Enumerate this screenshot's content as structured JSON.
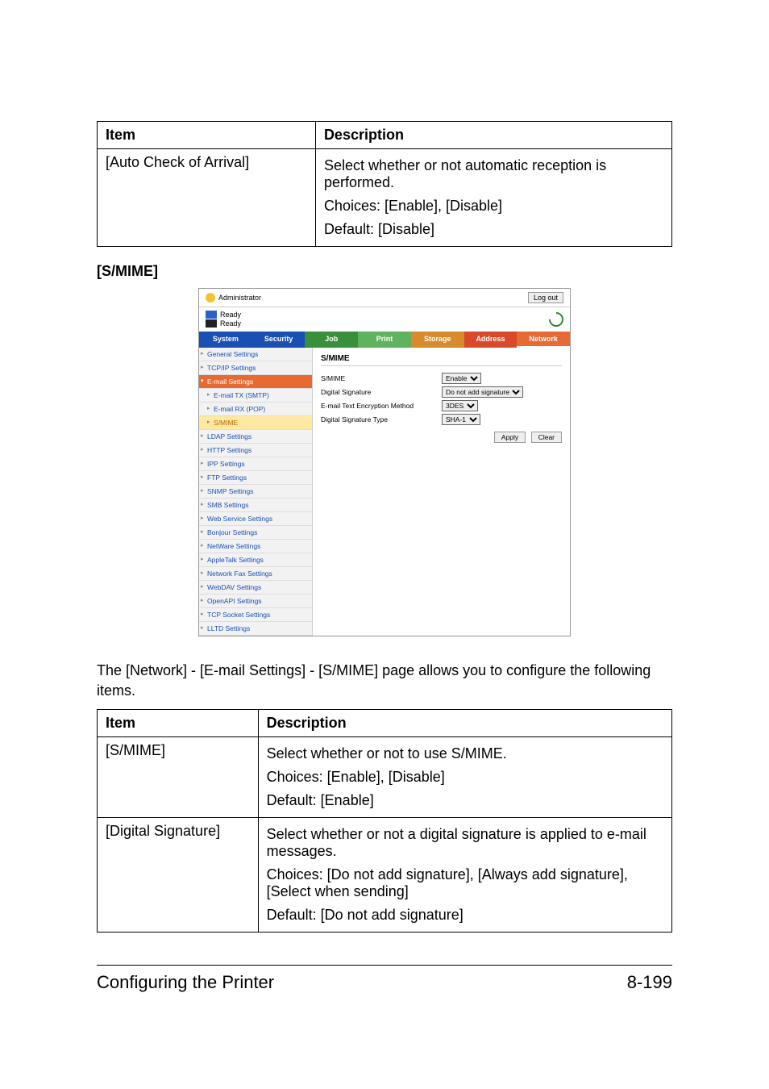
{
  "table1": {
    "headers": [
      "Item",
      "Description"
    ],
    "rows": [
      {
        "item": "[Auto Check of Arrival]",
        "lines": [
          "Select whether or not automatic reception is performed.",
          "Choices: [Enable], [Disable]",
          "Default: [Disable]"
        ]
      }
    ]
  },
  "section_heading": "[S/MIME]",
  "screenshot": {
    "admin_label": "Administrator",
    "logout": "Log out",
    "ready1": "Ready",
    "ready2": "Ready",
    "tabs": {
      "system": "System",
      "security": "Security",
      "job": "Job",
      "print": "Print",
      "storage": "Storage",
      "address": "Address",
      "network": "Network"
    },
    "sidebar": {
      "general": "General Settings",
      "tcpip": "TCP/IP Settings",
      "email": "E-mail Settings",
      "email_tx": "E-mail TX (SMTP)",
      "email_rx": "E-mail RX (POP)",
      "smime": "S/MIME",
      "ldap": "LDAP Settings",
      "http": "HTTP Settings",
      "ipp": "IPP Settings",
      "ftp": "FTP Settings",
      "snmp": "SNMP Settings",
      "smb": "SMB Settings",
      "webservice": "Web Service Settings",
      "bonjour": "Bonjour Settings",
      "netware": "NetWare Settings",
      "appletalk": "AppleTalk Settings",
      "networkfax": "Network Fax Settings",
      "webdav": "WebDAV Settings",
      "openapi": "OpenAPI Settings",
      "tcpsocket": "TCP Socket Settings",
      "lltd": "LLTD Settings"
    },
    "main": {
      "title": "S/MIME",
      "rows": {
        "smime": {
          "label": "S/MIME",
          "value": "Enable"
        },
        "sig": {
          "label": "Digital Signature",
          "value": "Do not add signature"
        },
        "enc": {
          "label": "E-mail Text Encryption Method",
          "value": "3DES"
        },
        "sigtype": {
          "label": "Digital Signature Type",
          "value": "SHA-1"
        }
      },
      "apply": "Apply",
      "clear": "Clear"
    }
  },
  "intro_text": "The [Network] - [E-mail Settings] - [S/MIME] page allows you to configure the following items.",
  "table2": {
    "headers": [
      "Item",
      "Description"
    ],
    "rows": [
      {
        "item": "[S/MIME]",
        "lines": [
          "Select whether or not to use S/MIME.",
          "Choices: [Enable], [Disable]",
          "Default: [Enable]"
        ]
      },
      {
        "item": "[Digital Signature]",
        "lines": [
          "Select whether or not a digital signature is applied to e-mail messages.",
          "Choices: [Do not add signature], [Always add signature], [Select when sending]",
          "Default: [Do not add signature]"
        ]
      }
    ]
  },
  "footer": {
    "left": "Configuring the Printer",
    "right": "8-199"
  }
}
